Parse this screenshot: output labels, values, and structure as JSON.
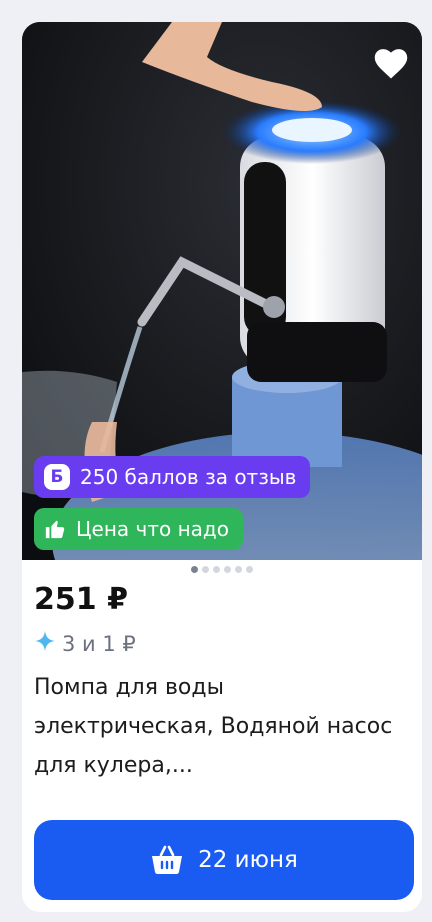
{
  "product": {
    "bonus_label": "250 баллов за отзыв",
    "bonus_icon_letter": "Б",
    "deal_label": "Цена что надо",
    "price": "251 ₽",
    "points": "3 и 1 ₽",
    "title": "Помпа для воды электрическая, Водяной насос для кулера,..."
  },
  "gallery": {
    "total": 6,
    "active": 1
  },
  "cart": {
    "label": "22 июня"
  },
  "colors": {
    "accent": "#1a5cf2",
    "bonus": "#6a3cf0",
    "deal": "#2fb65a"
  }
}
